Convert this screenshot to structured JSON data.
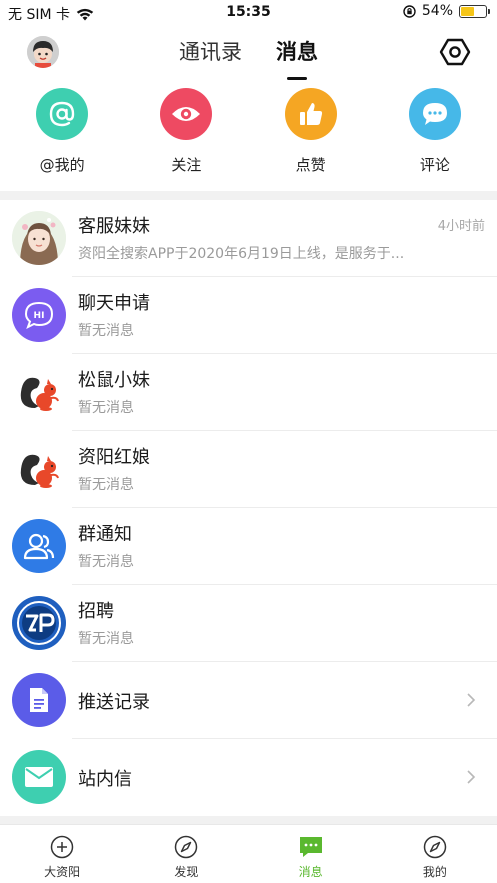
{
  "status_bar": {
    "carrier": "无 SIM 卡",
    "time": "15:35",
    "battery_percent": "54%",
    "battery_level": 0.54
  },
  "header": {
    "tabs": [
      {
        "label": "通讯录",
        "active": false
      },
      {
        "label": "消息",
        "active": true
      }
    ]
  },
  "quick_actions": [
    {
      "label": "@我的",
      "icon": "at-icon",
      "color": "#3ecfb0"
    },
    {
      "label": "关注",
      "icon": "eye-icon",
      "color": "#ee4a62"
    },
    {
      "label": "点赞",
      "icon": "thumbs-up-icon",
      "color": "#f5a623"
    },
    {
      "label": "评论",
      "icon": "comment-icon",
      "color": "#46b8e8"
    }
  ],
  "messages": [
    {
      "title": "客服妹妹",
      "subtitle": "资阳全搜索APP于2020年6月19日上线，是服务于...",
      "time": "4小时前",
      "avatar": "customer-service-avatar"
    },
    {
      "title": "聊天申请",
      "subtitle": "暂无消息",
      "avatar": "chat-request-icon",
      "color": "#7b5cf0"
    },
    {
      "title": "松鼠小妹",
      "subtitle": "暂无消息",
      "avatar": "squirrel-icon"
    },
    {
      "title": "资阳红娘",
      "subtitle": "暂无消息",
      "avatar": "squirrel-icon"
    },
    {
      "title": "群通知",
      "subtitle": "暂无消息",
      "avatar": "group-icon",
      "color": "#2f7be6"
    },
    {
      "title": "招聘",
      "subtitle": "暂无消息",
      "avatar": "recruit-logo"
    },
    {
      "title": "推送记录",
      "avatar": "document-icon",
      "color": "#5b5ce8",
      "chevron": true
    },
    {
      "title": "站内信",
      "avatar": "mail-icon",
      "color": "#3ecfb0",
      "chevron": true
    }
  ],
  "tab_bar": [
    {
      "label": "大资阳",
      "icon": "plus-circle-icon",
      "active": false
    },
    {
      "label": "发现",
      "icon": "compass-icon",
      "active": false
    },
    {
      "label": "消息",
      "icon": "message-icon",
      "active": true
    },
    {
      "label": "我的",
      "icon": "compass-icon",
      "active": false
    }
  ],
  "colors": {
    "accent": "#5ab82f"
  }
}
